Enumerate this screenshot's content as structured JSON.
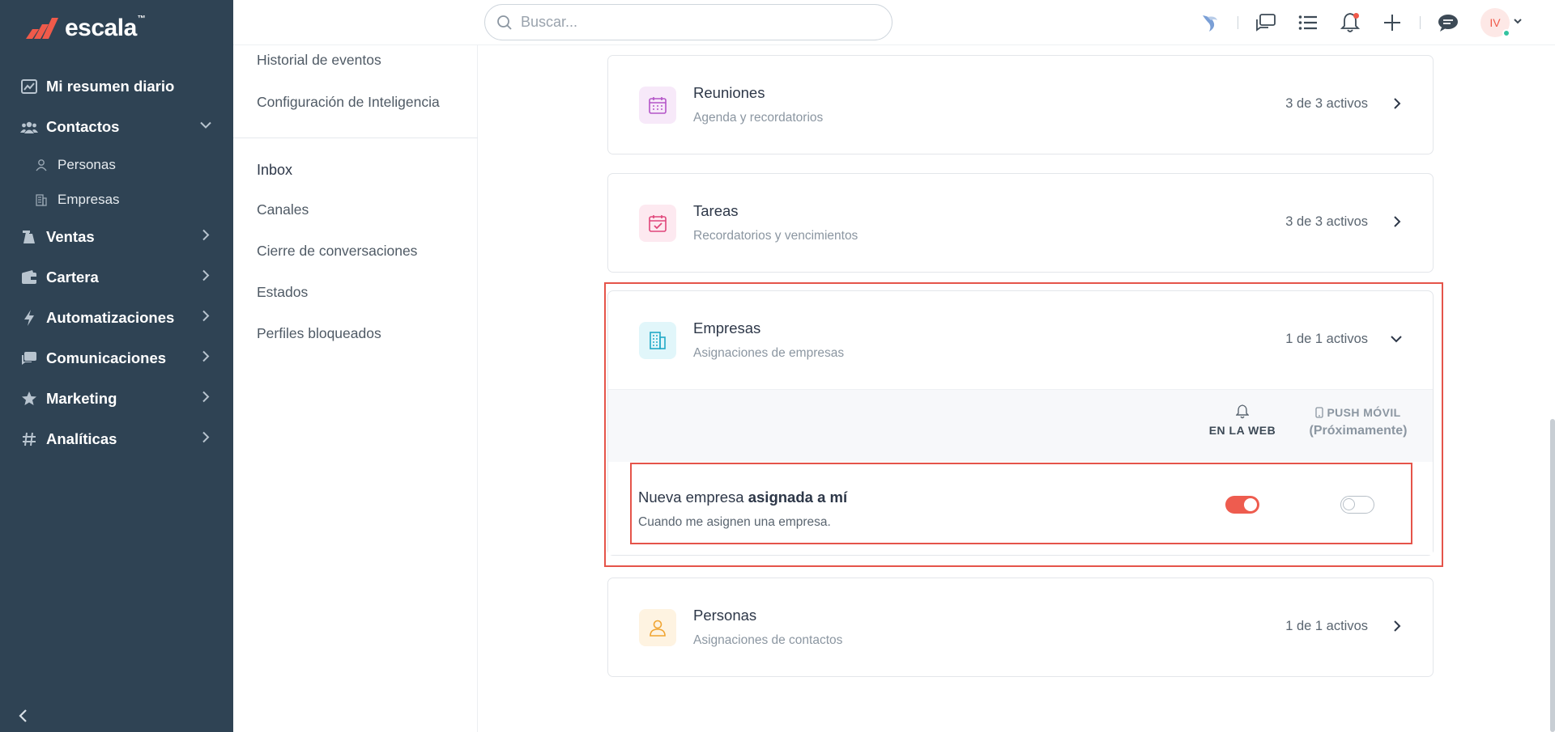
{
  "brand": {
    "name": "escala",
    "tm": "™"
  },
  "search": {
    "placeholder": "Buscar..."
  },
  "user": {
    "initials": "IV"
  },
  "sidebar": {
    "items": [
      {
        "label": "Mi resumen diario",
        "icon": "chart-line-icon"
      },
      {
        "label": "Contactos",
        "icon": "users-icon",
        "expanded": true
      },
      {
        "label": "Ventas",
        "icon": "handshake-icon"
      },
      {
        "label": "Cartera",
        "icon": "wallet-icon"
      },
      {
        "label": "Automatizaciones",
        "icon": "bolt-icon"
      },
      {
        "label": "Comunicaciones",
        "icon": "chat-icon"
      },
      {
        "label": "Marketing",
        "icon": "star-icon"
      },
      {
        "label": "Analíticas",
        "icon": "hashtag-icon"
      }
    ],
    "subitems": [
      {
        "label": "Personas",
        "icon": "person-icon"
      },
      {
        "label": "Empresas",
        "icon": "building-icon"
      }
    ]
  },
  "settings_menu": {
    "links_top": [
      "Historial de eventos",
      "Configuración de Inteligencia"
    ],
    "section_heading": "Inbox",
    "links_inbox": [
      "Canales",
      "Cierre de conversaciones",
      "Estados",
      "Perfiles bloqueados"
    ]
  },
  "cards": [
    {
      "title": "Reuniones",
      "subtitle": "Agenda y recordatorios",
      "count": "3 de 3 activos",
      "icon": "calendar-icon",
      "color": "#b455c8",
      "bg": "#f7e9f9"
    },
    {
      "title": "Tareas",
      "subtitle": "Recordatorios y vencimientos",
      "count": "3 de 3 activos",
      "icon": "calendar-check-icon",
      "color": "#e0467a",
      "bg": "#fde9f0"
    },
    {
      "title": "Empresas",
      "subtitle": "Asignaciones de empresas",
      "count": "1 de 1 activos",
      "icon": "building-icon",
      "color": "#21a9c7",
      "bg": "#e1f6fa",
      "expanded": true
    },
    {
      "title": "Personas",
      "subtitle": "Asignaciones de contactos",
      "count": "1 de 1 activos",
      "icon": "person-icon",
      "color": "#f0a431",
      "bg": "#fef3e1"
    }
  ],
  "channels": {
    "web": "EN LA WEB",
    "push": "PUSH MÓVIL",
    "push_soon": "(Próximamente)"
  },
  "notification": {
    "title_prefix": "Nueva empresa ",
    "title_bold": "asignada a mí",
    "description": "Cuando me asignen una empresa.",
    "web_enabled": true,
    "push_enabled": false
  },
  "colors": {
    "sidebar_bg": "#2f4354",
    "accent": "#ee5c4f",
    "highlight": "#e5544a"
  }
}
